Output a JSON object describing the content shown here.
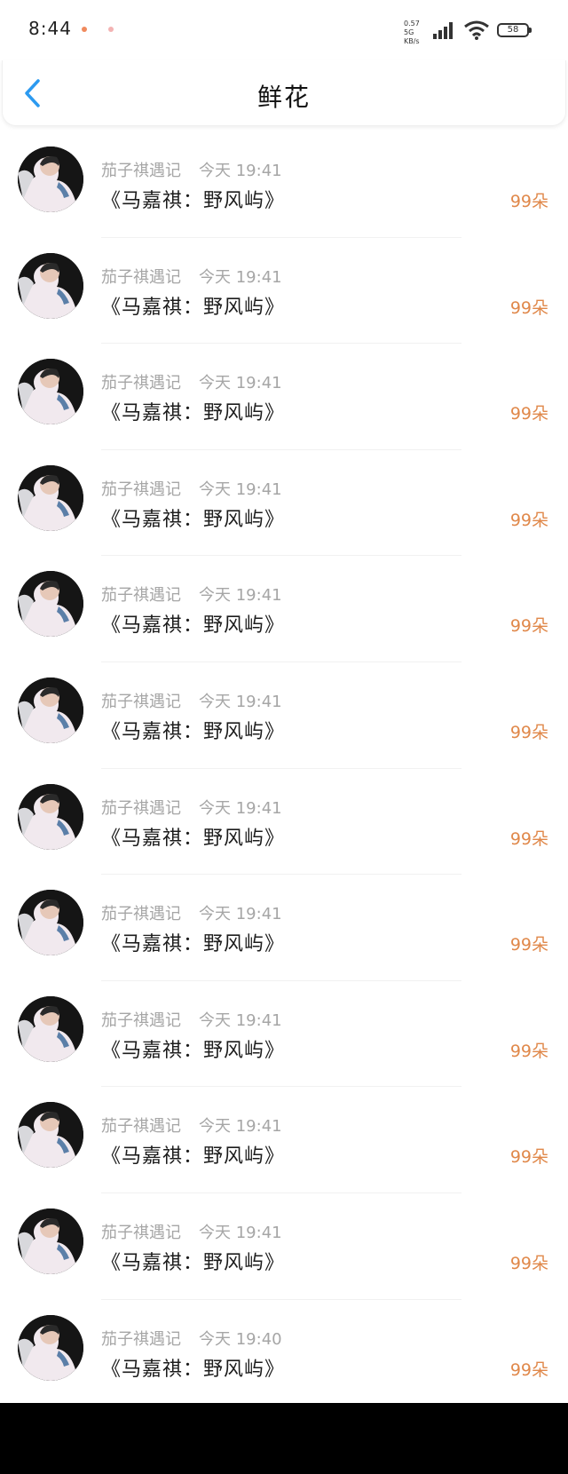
{
  "status_bar": {
    "time": "8:44",
    "net_speed": "0.57 5G KB/s",
    "battery": "58",
    "notif_colors": [
      "#f08a5d",
      "#f3b3b3"
    ]
  },
  "header": {
    "title": "鲜花",
    "back_icon": "chevron-left-icon",
    "accent": "#2c9af0"
  },
  "list": {
    "items": [
      {
        "user": "茄子祺遇记",
        "time": "今天 19:41",
        "work": "《马嘉祺：野风屿》",
        "count": "99朵"
      },
      {
        "user": "茄子祺遇记",
        "time": "今天 19:41",
        "work": "《马嘉祺：野风屿》",
        "count": "99朵"
      },
      {
        "user": "茄子祺遇记",
        "time": "今天 19:41",
        "work": "《马嘉祺：野风屿》",
        "count": "99朵"
      },
      {
        "user": "茄子祺遇记",
        "time": "今天 19:41",
        "work": "《马嘉祺：野风屿》",
        "count": "99朵"
      },
      {
        "user": "茄子祺遇记",
        "time": "今天 19:41",
        "work": "《马嘉祺：野风屿》",
        "count": "99朵"
      },
      {
        "user": "茄子祺遇记",
        "time": "今天 19:41",
        "work": "《马嘉祺：野风屿》",
        "count": "99朵"
      },
      {
        "user": "茄子祺遇记",
        "time": "今天 19:41",
        "work": "《马嘉祺：野风屿》",
        "count": "99朵"
      },
      {
        "user": "茄子祺遇记",
        "time": "今天 19:41",
        "work": "《马嘉祺：野风屿》",
        "count": "99朵"
      },
      {
        "user": "茄子祺遇记",
        "time": "今天 19:41",
        "work": "《马嘉祺：野风屿》",
        "count": "99朵"
      },
      {
        "user": "茄子祺遇记",
        "time": "今天 19:41",
        "work": "《马嘉祺：野风屿》",
        "count": "99朵"
      },
      {
        "user": "茄子祺遇记",
        "time": "今天 19:41",
        "work": "《马嘉祺：野风屿》",
        "count": "99朵"
      },
      {
        "user": "茄子祺遇记",
        "time": "今天 19:40",
        "work": "《马嘉祺：野风屿》",
        "count": "99朵"
      }
    ]
  }
}
